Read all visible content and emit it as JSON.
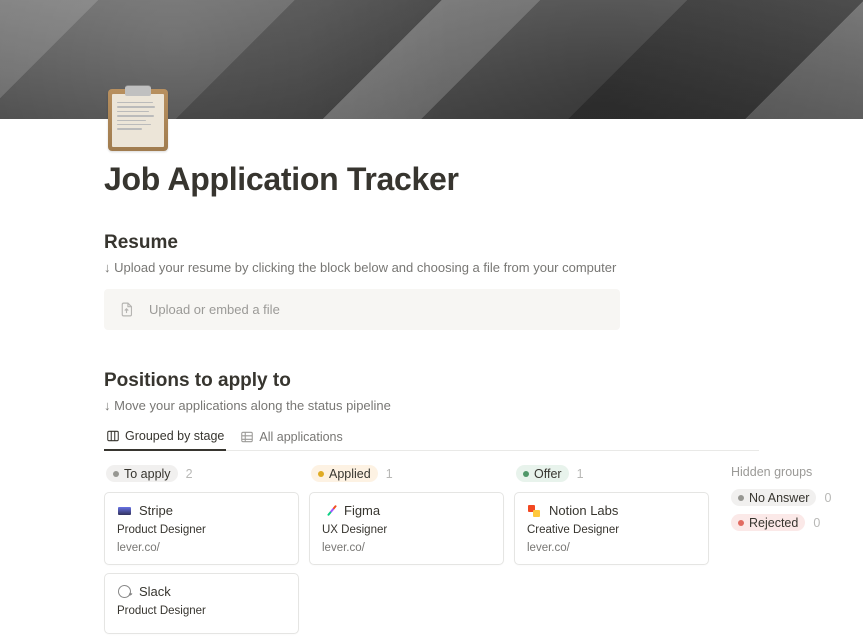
{
  "page": {
    "title": "Job Application Tracker"
  },
  "resume": {
    "heading": "Resume",
    "helper": "↓ Upload your resume by clicking the block below and choosing a file from your computer",
    "upload_label": "Upload or embed a file"
  },
  "positions": {
    "heading": "Positions to apply to",
    "helper": "↓ Move your applications along the status pipeline"
  },
  "tabs": [
    {
      "label": "Grouped by stage",
      "active": true
    },
    {
      "label": "All applications",
      "active": false
    }
  ],
  "board": {
    "columns": [
      {
        "id": "to-apply",
        "label": "To apply",
        "count": "2",
        "pill_bg": "#f1f0ef",
        "dot": "#979792",
        "cards": [
          {
            "logo": "stripe",
            "company": "Stripe",
            "role": "Product Designer",
            "link": "lever.co/"
          },
          {
            "logo": "slack",
            "company": "Slack",
            "role": "Product Designer",
            "link": ""
          }
        ]
      },
      {
        "id": "applied",
        "label": "Applied",
        "count": "1",
        "pill_bg": "#fdf2e3",
        "dot": "#dfab24",
        "cards": [
          {
            "logo": "figma",
            "company": "Figma",
            "role": "UX Designer",
            "link": "lever.co/"
          }
        ]
      },
      {
        "id": "offer",
        "label": "Offer",
        "count": "1",
        "pill_bg": "#e8f3ec",
        "dot": "#4f9768",
        "cards": [
          {
            "logo": "notion",
            "company": "Notion Labs",
            "role": "Creative Designer",
            "link": "lever.co/"
          }
        ]
      }
    ],
    "hidden": {
      "title": "Hidden groups",
      "groups": [
        {
          "label": "No Answer",
          "count": "0",
          "pill_bg": "#f1f0ef",
          "dot": "#979792"
        },
        {
          "label": "Rejected",
          "count": "0",
          "pill_bg": "#fbe9e8",
          "dot": "#e16b61"
        }
      ]
    }
  }
}
